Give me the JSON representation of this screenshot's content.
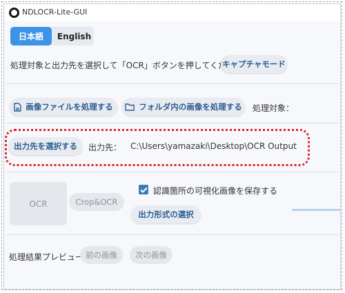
{
  "window": {
    "title": "NDLOCR-Lite-GUI"
  },
  "language": {
    "japanese_label": "日本語",
    "english_label": "English"
  },
  "instruction": {
    "text": "処理対象と出力先を選択して「OCR」ボタンを押してください",
    "capture_mode_label": "キャプチャモード"
  },
  "source": {
    "process_file_label": "画像ファイルを処理する",
    "process_folder_label": "フォルダ内の画像を処理する",
    "target_label": "処理対象："
  },
  "output": {
    "select_button_label": "出力先を選択する",
    "dest_label": "出力先：",
    "dest_path": "C:\\Users\\yamazaki\\Desktop\\OCR Output"
  },
  "ocr": {
    "ocr_label": "OCR",
    "crop_ocr_label": "Crop&OCR",
    "save_visualization_label": "認識箇所の可視化画像を保存する",
    "save_visualization_checked": true,
    "format_button_label": "出力形式の選択"
  },
  "preview": {
    "label": "処理結果プレビュー",
    "prev_label": "前の画像",
    "next_label": "次の画像"
  },
  "colors": {
    "accent": "#3d93e8",
    "button_text": "#2d5d8f",
    "highlight": "#d9262b"
  }
}
